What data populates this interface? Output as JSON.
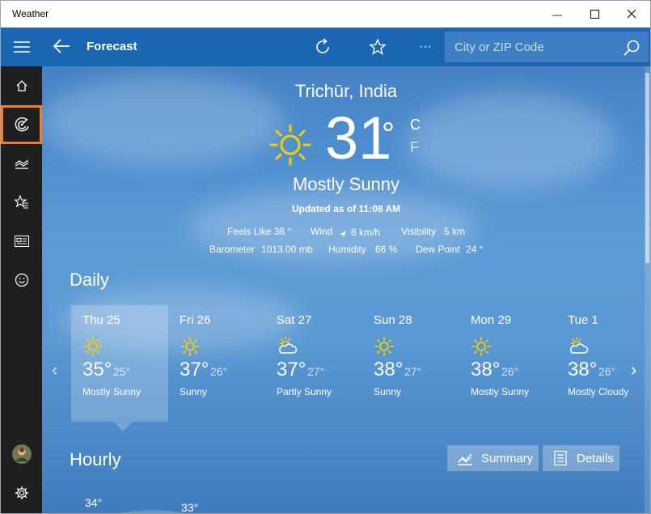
{
  "window": {
    "title": "Weather",
    "minimize_glyph": "—",
    "maximize_glyph": "☐",
    "close_glyph": "✕"
  },
  "nav": {
    "items": [
      {
        "name": "hamburger-icon"
      },
      {
        "name": "home-icon"
      },
      {
        "name": "forecast-radar-icon",
        "selected": true
      },
      {
        "name": "historical-weather-icon"
      },
      {
        "name": "favorites-icon"
      },
      {
        "name": "news-icon"
      },
      {
        "name": "feedback-smiley-icon"
      }
    ],
    "avatar_icon": "avatar",
    "settings_icon": "gear-icon"
  },
  "appbar": {
    "title": "Forecast",
    "more_glyph": "···",
    "search_placeholder": "City or ZIP Code"
  },
  "current": {
    "city": "Trichūr, India",
    "temp": "31",
    "deg": "°",
    "unit_c": "C",
    "unit_f": "F",
    "condition": "Mostly Sunny",
    "updated": "Updated as of 11:08 AM",
    "feels_like_label": "Feels Like",
    "feels_like": "36 °",
    "wind_label": "Wind",
    "wind": "8 km/h",
    "visibility_label": "Visibility",
    "visibility": "5 km",
    "barometer_label": "Barometer",
    "barometer": "1013.00 mb",
    "humidity_label": "Humidity",
    "humidity": "66 %",
    "dewpoint_label": "Dew Point",
    "dewpoint": "24 °"
  },
  "daily": {
    "title": "Daily",
    "prev_glyph": "‹",
    "next_glyph": "›",
    "days": [
      {
        "day": "Thu 25",
        "hi": "35°",
        "lo": "25°",
        "cond": "Mostly Sunny",
        "icon": "sun"
      },
      {
        "day": "Fri 26",
        "hi": "37°",
        "lo": "26°",
        "cond": "Sunny",
        "icon": "sun"
      },
      {
        "day": "Sat 27",
        "hi": "37°",
        "lo": "27°",
        "cond": "Partly Sunny",
        "icon": "partly-cloudy"
      },
      {
        "day": "Sun 28",
        "hi": "38°",
        "lo": "27°",
        "cond": "Sunny",
        "icon": "sun"
      },
      {
        "day": "Mon 29",
        "hi": "38°",
        "lo": "26°",
        "cond": "Mostly Sunny",
        "icon": "sun"
      },
      {
        "day": "Tue 1",
        "hi": "38°",
        "lo": "26°",
        "cond": "Mostly Cloudy",
        "icon": "partly-cloudy"
      }
    ]
  },
  "hourly": {
    "title": "Hourly",
    "summary_label": "Summary",
    "details_label": "Details",
    "temps": [
      "34°",
      "33°"
    ]
  },
  "colors": {
    "accent": "#1b66b1",
    "nav_bg": "#1e1f20",
    "highlight": "#f57d22",
    "sun": "#f5d000"
  }
}
